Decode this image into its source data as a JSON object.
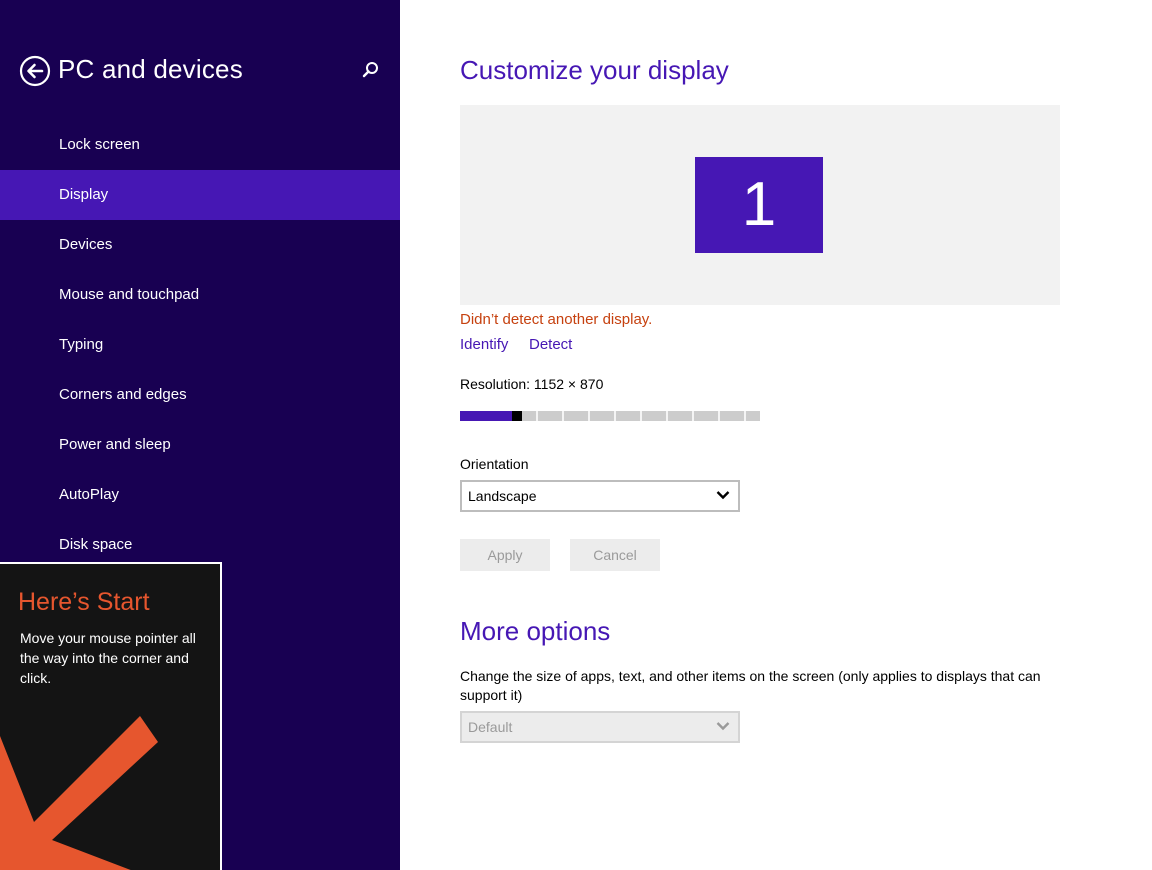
{
  "sidebar": {
    "title": "PC and devices",
    "back_icon": "back-arrow-circle-icon",
    "search_icon": "search-icon",
    "selected_index": 1,
    "items": [
      {
        "label": "Lock screen"
      },
      {
        "label": "Display"
      },
      {
        "label": "Devices"
      },
      {
        "label": "Mouse and touchpad"
      },
      {
        "label": "Typing"
      },
      {
        "label": "Corners and edges"
      },
      {
        "label": "Power and sleep"
      },
      {
        "label": "AutoPlay"
      },
      {
        "label": "Disk space"
      }
    ]
  },
  "tip": {
    "title": "Here’s Start",
    "body": "Move your mouse pointer all the way into the corner and click.",
    "arrow_icon": "arrow-down-left-icon"
  },
  "main": {
    "title": "Customize your display",
    "monitor_number": "1",
    "warning": "Didn’t detect another display.",
    "identify_label": "Identify",
    "detect_label": "Detect",
    "resolution_label": "Resolution: 1152 × 870",
    "resolution_slider": {
      "steps": 12,
      "selected_step": 2
    },
    "orientation_label": "Orientation",
    "orientation_value": "Landscape",
    "apply_label": "Apply",
    "cancel_label": "Cancel",
    "more_options_title": "More options",
    "scale_description": "Change the size of apps, text, and other items on the screen (only applies to displays that can support it)",
    "scale_value": "Default"
  },
  "colors": {
    "sidebar_bg": "#180052",
    "accent": "#4617b4",
    "warning": "#c6410f",
    "tip_accent": "#e6562e",
    "tip_bg": "#141414"
  }
}
